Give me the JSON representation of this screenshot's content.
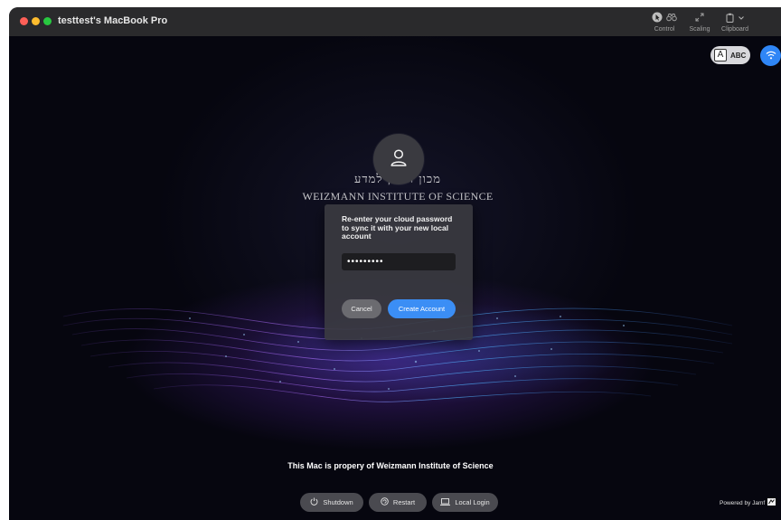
{
  "window": {
    "title": "testtest's MacBook Pro",
    "toolbar": {
      "control_label": "Control",
      "scaling_label": "Scaling",
      "clipboard_label": "Clipboard"
    }
  },
  "top_right": {
    "input_source_letter": "A",
    "input_source_label": "ABC",
    "wifi_icon": "wifi-icon"
  },
  "login": {
    "avatar_icon": "user-icon",
    "logo_hebrew": "מכון ויצמן למדע",
    "logo_english": "WEIZMANN INSTITUTE OF SCIENCE"
  },
  "dialog": {
    "message": "Re-enter your cloud password to sync it with your new local account",
    "password_value": "•••••••••",
    "cancel_label": "Cancel",
    "create_label": "Create Account"
  },
  "footer": {
    "ownership_text": "This Mac is propery of Weizmann Institute of Science",
    "shutdown_label": "Shutdown",
    "restart_label": "Restart",
    "local_login_label": "Local Login",
    "powered_by": "Powered by Jamf"
  },
  "colors": {
    "accent": "#3b8ef5",
    "titlebar": "#2a2a2c",
    "background": "#05050c"
  }
}
